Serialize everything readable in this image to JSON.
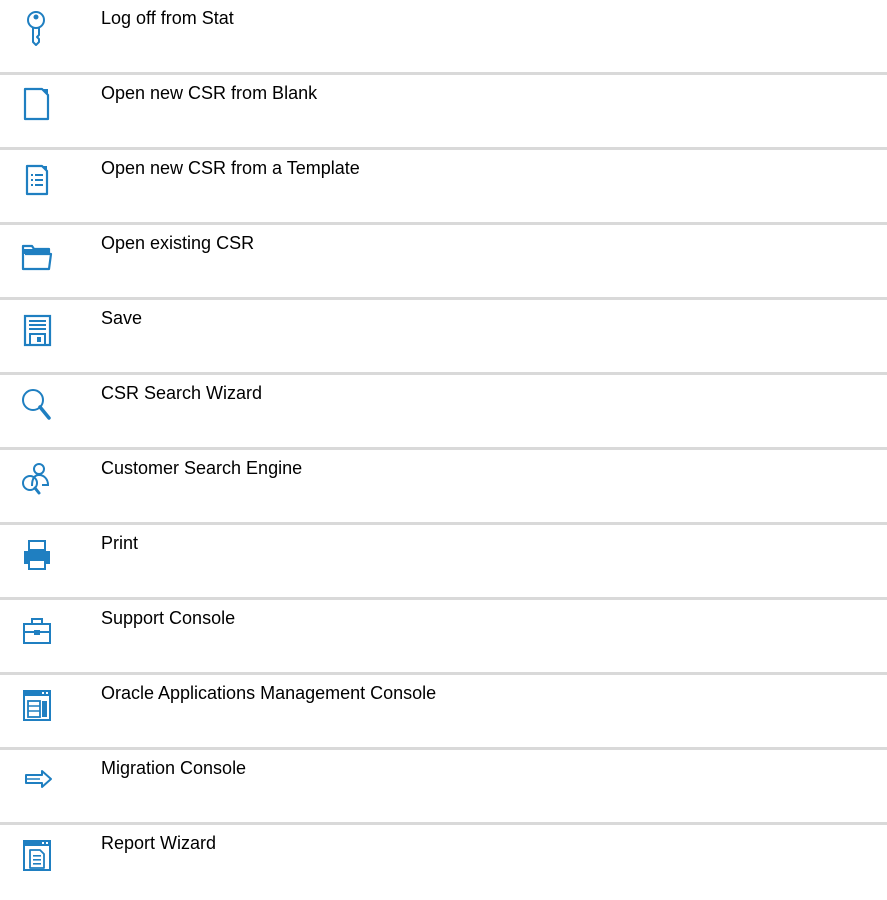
{
  "accent_color": "#1f7fc1",
  "rows": [
    {
      "icon": "key-icon",
      "label": "Log off from Stat"
    },
    {
      "icon": "blank-document-icon",
      "label": "Open new CSR from Blank"
    },
    {
      "icon": "template-document-icon",
      "label": "Open new CSR from a Template"
    },
    {
      "icon": "folder-icon",
      "label": "Open existing CSR"
    },
    {
      "icon": "floppy-disk-icon",
      "label": "Save"
    },
    {
      "icon": "magnifier-icon",
      "label": "CSR Search Wizard"
    },
    {
      "icon": "customer-search-icon",
      "label": "Customer Search Engine"
    },
    {
      "icon": "printer-icon",
      "label": "Print"
    },
    {
      "icon": "briefcase-icon",
      "label": "Support Console"
    },
    {
      "icon": "console-window-icon",
      "label": "Oracle Applications Management Console"
    },
    {
      "icon": "arrow-right-icon",
      "label": "Migration Console"
    },
    {
      "icon": "report-window-icon",
      "label": "Report Wizard"
    }
  ]
}
